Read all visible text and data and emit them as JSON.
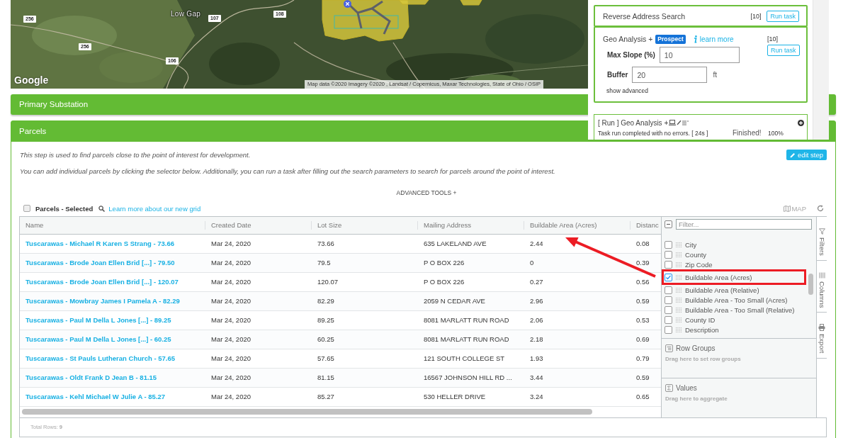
{
  "map": {
    "place_labels": [
      "Low Gap"
    ],
    "road_shields": [
      "256",
      "107",
      "108",
      "256",
      "106"
    ],
    "logo": "Google",
    "attribution": "Map data ©2020 Imagery ©2020 , Landsat / Copernicus, Maxar Technologies, State of Ohio / OSIP"
  },
  "task_panel": {
    "cards": [
      {
        "kind": "simple",
        "title": "Reverse Address Search",
        "count": "[10]",
        "button": "Run task"
      },
      {
        "kind": "form",
        "title": "Geo Analysis +",
        "badge": "Prospect",
        "info_link": "learn more",
        "count": "[10]",
        "button": "Run task",
        "fields": [
          {
            "label": "Max Slope (%)",
            "value": "10"
          },
          {
            "label": "Buffer",
            "value": "20",
            "unit": "ft"
          }
        ],
        "toggle": "show advanced"
      }
    ],
    "run_log": {
      "title": "[ Run ] Geo Analysis +",
      "message": "Task run completed with no errors. [ 24s ]",
      "status": "Finished!",
      "percent": "100%"
    }
  },
  "collapsed_section": {
    "title": "Primary Substation"
  },
  "parcels_step": {
    "title": "Parcels",
    "edit_button": "edit step",
    "intro": [
      "This step is used to find parcels close to the point of interest for development.",
      "You can add individual parcels by clicking the selector below. Additionally, you can run a task after filling out the search parameters to search for parcels around the point of interest."
    ],
    "advanced_tools": "ADVANCED TOOLS +",
    "grid": {
      "select_all_checked": false,
      "title": "Parcels - Selected",
      "help_link": "Learn more about our new grid",
      "map_button": "MAP",
      "columns": [
        "Name",
        "Created Date",
        "Lot Size",
        "Mailing Address",
        "Buildable Area (Acres)",
        "Distanc"
      ],
      "rows": [
        [
          "Tuscarawas - Michael R Karen S Strang - 73.66",
          "Mar 24, 2020",
          "73.66",
          "635 LAKELAND AVE",
          "2.44",
          "0.08"
        ],
        [
          "Tuscarawas - Brode Joan Ellen Brid [...] - 79.50",
          "Mar 24, 2020",
          "79.5",
          "P O BOX 226",
          "0",
          "0.39"
        ],
        [
          "Tuscarawas - Brode Joan Ellen Brid [...] - 120.07",
          "Mar 24, 2020",
          "120.07",
          "P O BOX 226",
          "0.27",
          "0.56"
        ],
        [
          "Tuscarawas - Mowbray James I Pamela A - 82.29",
          "Mar 24, 2020",
          "82.29",
          "2059 N CEDAR AVE",
          "2.96",
          "0.59"
        ],
        [
          "Tuscarawas - Paul M Della L Jones [...] - 89.25",
          "Mar 24, 2020",
          "89.25",
          "8081 MARLATT RUN ROAD",
          "2.06",
          "0.53"
        ],
        [
          "Tuscarawas - Paul M Della L Jones [...] - 60.25",
          "Mar 24, 2020",
          "60.25",
          "8081 MARLATT RUN ROAD",
          "2.18",
          "0.69"
        ],
        [
          "Tuscarawas - St Pauls Lutheran Church - 57.65",
          "Mar 24, 2020",
          "57.65",
          "121 SOUTH COLLEGE ST",
          "1.93",
          "0.79"
        ],
        [
          "Tuscarawas - Oldt Frank D Jean B - 81.15",
          "Mar 24, 2020",
          "81.15",
          "16567 JOHNSON HILL RD ...",
          "3.44",
          "0.59"
        ],
        [
          "Tuscarawas - Kehl Michael W Julie A - 85.27",
          "Mar 24, 2020",
          "85.27",
          "530 HELLER DRIVE",
          "3.24",
          "0.65"
        ]
      ],
      "footer": "Total Rows: **9**",
      "column_tool_panel": {
        "select_all_indeterminate": true,
        "filter_placeholder": "Filter...",
        "columns": [
          {
            "label": "City",
            "checked": false,
            "highlighted": false
          },
          {
            "label": "County",
            "checked": false,
            "highlighted": false
          },
          {
            "label": "Zip Code",
            "checked": false,
            "highlighted": false
          },
          {
            "label": "Buildable Area (Acres)",
            "checked": true,
            "highlighted": true
          },
          {
            "label": "Buildable Area (Relative)",
            "checked": false,
            "highlighted": false
          },
          {
            "label": "Buildable Area - Too Small (Acres)",
            "checked": false,
            "highlighted": false
          },
          {
            "label": "Buildable Area - Too Small (Relative)",
            "checked": false,
            "highlighted": false
          },
          {
            "label": "County ID",
            "checked": false,
            "highlighted": false
          },
          {
            "label": "Description",
            "checked": false,
            "highlighted": false
          }
        ],
        "row_groups": {
          "title": "Row Groups",
          "hint": "Drag here to set row groups"
        },
        "values": {
          "title": "Values",
          "hint": "Drag here to aggregate"
        }
      },
      "side_tabs": [
        {
          "label": "Filters",
          "kind": "filter"
        },
        {
          "label": "Columns",
          "kind": "columns"
        },
        {
          "label": "Export",
          "kind": "export"
        }
      ]
    }
  }
}
